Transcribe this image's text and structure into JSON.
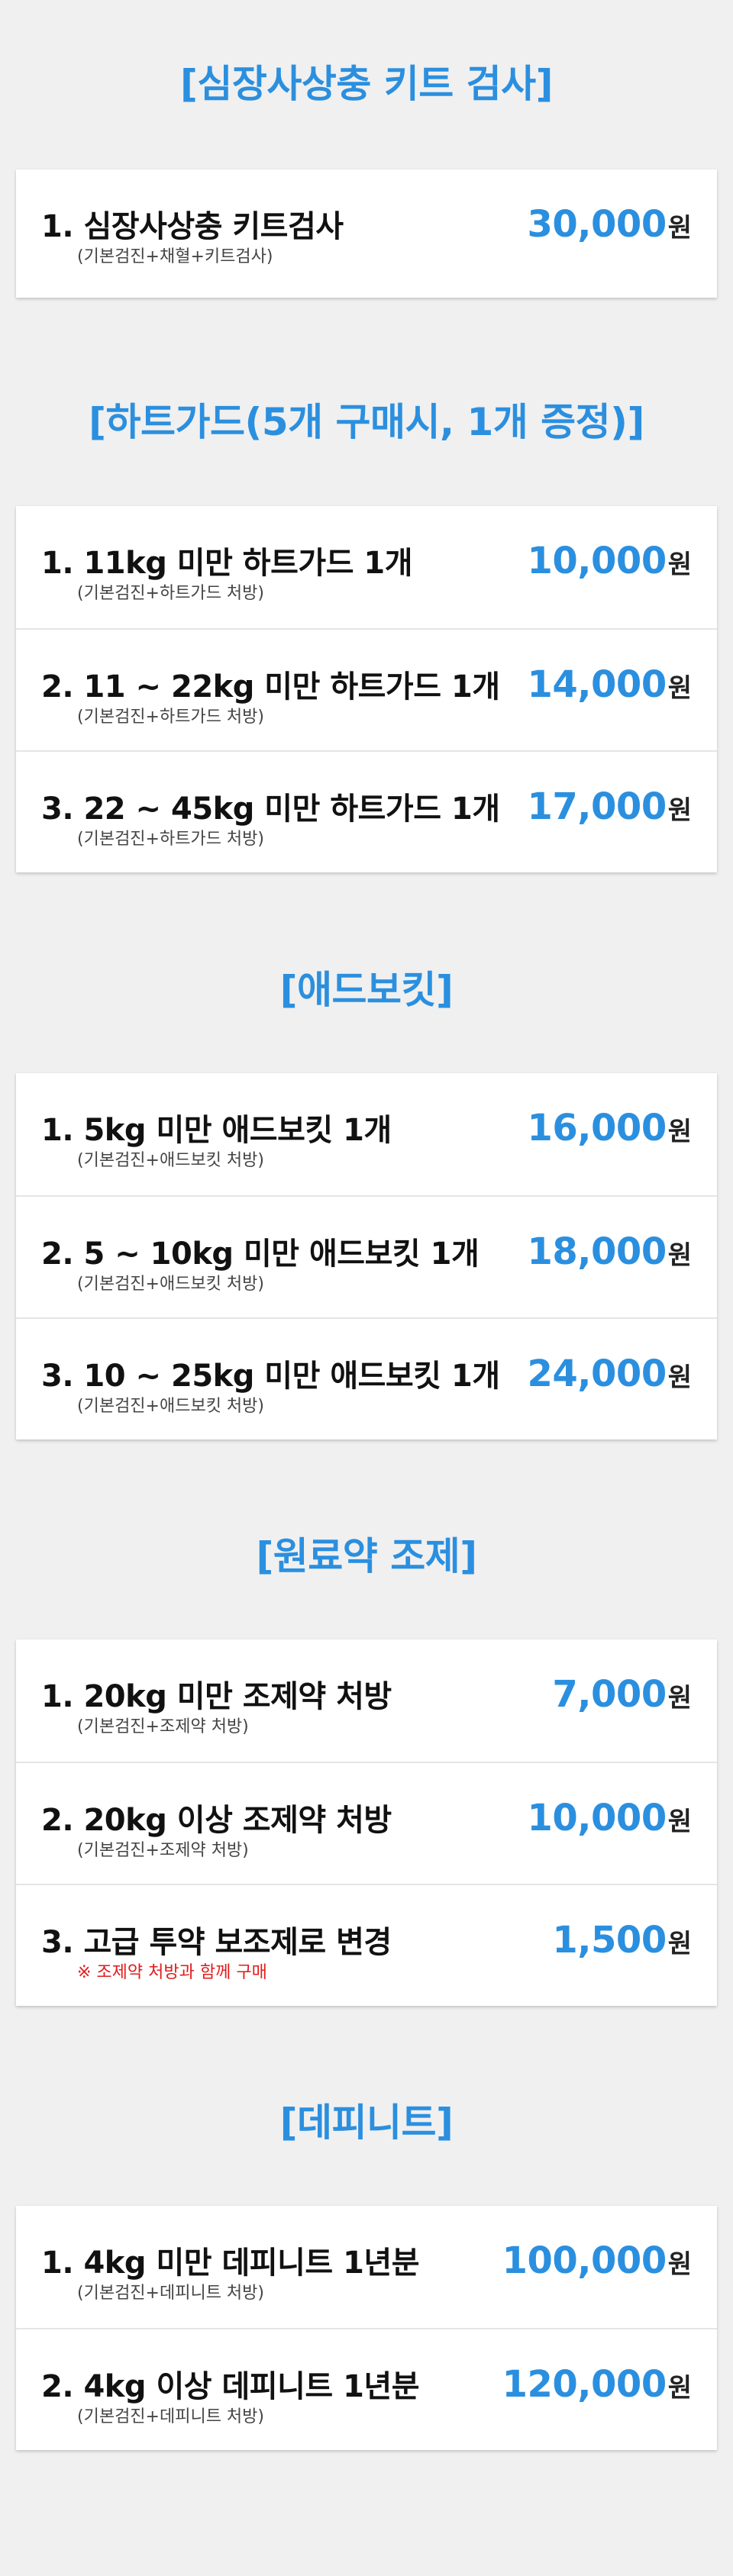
{
  "sections": [
    {
      "title": "[심장사상충 키트 검사]",
      "items": [
        {
          "name": "1. 심장사상충 키트검사",
          "sub": "(기본검진+채혈+키트검사)",
          "price": "30,000",
          "unit": "원"
        }
      ]
    },
    {
      "title": "[하트가드(5개 구매시, 1개 증정)]",
      "items": [
        {
          "name": "1. 11kg 미만 하트가드 1개",
          "sub": "(기본검진+하트가드 처방)",
          "price": "10,000",
          "unit": "원"
        },
        {
          "name": "2. 11 ~ 22kg 미만 하트가드 1개",
          "sub": "(기본검진+하트가드 처방)",
          "price": "14,000",
          "unit": "원"
        },
        {
          "name": "3. 22 ~ 45kg 미만 하트가드 1개",
          "sub": "(기본검진+하트가드 처방)",
          "price": "17,000",
          "unit": "원"
        }
      ]
    },
    {
      "title": "[애드보킷]",
      "items": [
        {
          "name": "1. 5kg 미만 애드보킷 1개",
          "sub": "(기본검진+애드보킷 처방)",
          "price": "16,000",
          "unit": "원"
        },
        {
          "name": "2. 5 ~ 10kg 미만 애드보킷 1개",
          "sub": "(기본검진+애드보킷 처방)",
          "price": "18,000",
          "unit": "원"
        },
        {
          "name": "3. 10 ~ 25kg 미만 애드보킷 1개",
          "sub": "(기본검진+애드보킷 처방)",
          "price": "24,000",
          "unit": "원"
        }
      ]
    },
    {
      "title": "[원료약 조제]",
      "items": [
        {
          "name": "1. 20kg 미만 조제약 처방",
          "sub": "(기본검진+조제약 처방)",
          "price": "7,000",
          "unit": "원"
        },
        {
          "name": "2. 20kg 이상 조제약 처방",
          "sub": "(기본검진+조제약 처방)",
          "price": "10,000",
          "unit": "원"
        },
        {
          "name": "3. 고급 투약 보조제로 변경",
          "note": "※ 조제약 처방과 함께 구매",
          "price": "1,500",
          "unit": "원"
        }
      ]
    },
    {
      "title": "[데피니트]",
      "items": [
        {
          "name": "1. 4kg 미만 데피니트 1년분",
          "sub": "(기본검진+데피니트 처방)",
          "price": "100,000",
          "unit": "원"
        },
        {
          "name": "2. 4kg 이상 데피니트 1년분",
          "sub": "(기본검진+데피니트 처방)",
          "price": "120,000",
          "unit": "원"
        }
      ]
    }
  ]
}
